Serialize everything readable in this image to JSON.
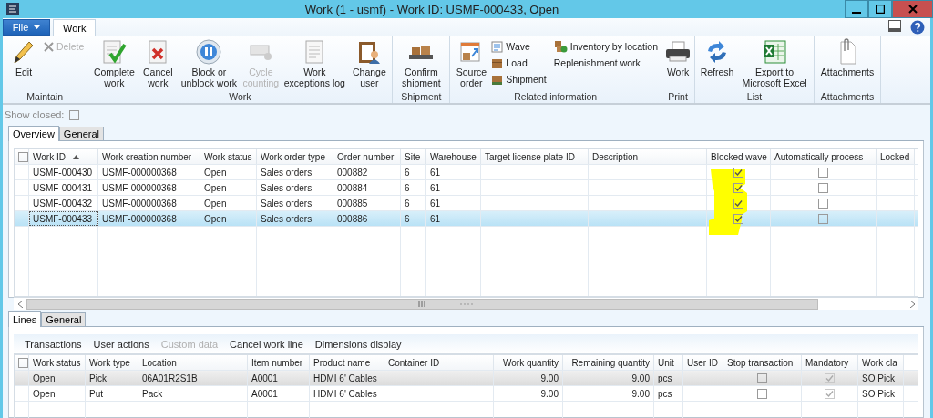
{
  "window": {
    "title": "Work (1 - usmf) - Work ID: USMF-000433, Open"
  },
  "menu": {
    "file": "File",
    "tabs": [
      {
        "label": "Work",
        "selected": true
      }
    ]
  },
  "ribbon": {
    "groups": [
      {
        "label": "Maintain",
        "buttons": [
          {
            "label": "Edit",
            "kind": "large",
            "disabled": false
          },
          {
            "label": "Delete",
            "kind": "small",
            "disabled": true
          }
        ]
      },
      {
        "label": "Work",
        "buttons": [
          {
            "label": "Complete work",
            "kind": "large",
            "disabled": false
          },
          {
            "label": "Cancel work",
            "kind": "large",
            "disabled": false
          },
          {
            "label": "Block or unblock work",
            "kind": "large",
            "disabled": false
          },
          {
            "label": "Cycle counting",
            "kind": "large",
            "disabled": true
          },
          {
            "label": "Work exceptions log",
            "kind": "large",
            "disabled": false
          },
          {
            "label": "Change user",
            "kind": "large",
            "disabled": false
          }
        ]
      },
      {
        "label": "Shipment",
        "buttons": [
          {
            "label": "Confirm shipment",
            "kind": "large",
            "disabled": false
          }
        ]
      },
      {
        "label": "Related information",
        "buttons": [
          {
            "label": "Source order",
            "kind": "large",
            "disabled": false
          },
          {
            "label": "Wave",
            "kind": "small",
            "disabled": false
          },
          {
            "label": "Load",
            "kind": "small",
            "disabled": false
          },
          {
            "label": "Shipment",
            "kind": "small",
            "disabled": false
          },
          {
            "label": "Inventory by location",
            "kind": "small",
            "disabled": false
          },
          {
            "label": "Replenishment work",
            "kind": "small",
            "disabled": false
          }
        ]
      },
      {
        "label": "Print",
        "buttons": [
          {
            "label": "Work",
            "kind": "large",
            "disabled": false
          }
        ]
      },
      {
        "label": "List",
        "buttons": [
          {
            "label": "Refresh",
            "kind": "large",
            "disabled": false
          },
          {
            "label": "Export to Microsoft Excel",
            "kind": "large",
            "disabled": false
          }
        ]
      },
      {
        "label": "Attachments",
        "buttons": [
          {
            "label": "Attachments",
            "kind": "large",
            "disabled": false
          }
        ]
      }
    ]
  },
  "show_closed": {
    "label": "Show closed:",
    "checked": false
  },
  "header_section": {
    "tabs": [
      {
        "label": "Overview",
        "selected": true
      },
      {
        "label": "General",
        "selected": false
      }
    ],
    "grid": {
      "select_all_checked": false,
      "columns": [
        {
          "label": "Work ID",
          "kind": "text",
          "sort_ascending": true
        },
        {
          "label": "Work creation number",
          "kind": "text"
        },
        {
          "label": "Work status",
          "kind": "text"
        },
        {
          "label": "Work order type",
          "kind": "text"
        },
        {
          "label": "Order number",
          "kind": "text"
        },
        {
          "label": "Site",
          "kind": "text"
        },
        {
          "label": "Warehouse",
          "kind": "text"
        },
        {
          "label": "Target license plate ID",
          "kind": "text"
        },
        {
          "label": "Description",
          "kind": "text"
        },
        {
          "label": "Blocked wave",
          "kind": "check"
        },
        {
          "label": "Automatically process",
          "kind": "check"
        },
        {
          "label": "Locked",
          "kind": "text"
        }
      ],
      "rows": [
        {
          "selected": false,
          "cells": [
            "USMF-000430",
            "USMF-000000368",
            "Open",
            "Sales orders",
            "000882",
            "6",
            "61",
            "",
            "",
            true,
            false,
            ""
          ]
        },
        {
          "selected": false,
          "cells": [
            "USMF-000431",
            "USMF-000000368",
            "Open",
            "Sales orders",
            "000884",
            "6",
            "61",
            "",
            "",
            true,
            false,
            ""
          ]
        },
        {
          "selected": false,
          "cells": [
            "USMF-000432",
            "USMF-000000368",
            "Open",
            "Sales orders",
            "000885",
            "6",
            "61",
            "",
            "",
            true,
            false,
            ""
          ]
        },
        {
          "selected": true,
          "cells": [
            "USMF-000433",
            "USMF-000000368",
            "Open",
            "Sales orders",
            "000886",
            "6",
            "61",
            "",
            "",
            true,
            false,
            ""
          ]
        }
      ]
    }
  },
  "lines_section": {
    "tabs": [
      {
        "label": "Lines",
        "selected": true
      },
      {
        "label": "General",
        "selected": false
      }
    ],
    "actions": [
      {
        "label": "Transactions",
        "disabled": false
      },
      {
        "label": "User actions",
        "disabled": false
      },
      {
        "label": "Custom data",
        "disabled": true
      },
      {
        "label": "Cancel work line",
        "disabled": false
      },
      {
        "label": "Dimensions display",
        "disabled": false
      }
    ],
    "grid": {
      "select_all_checked": false,
      "columns": [
        {
          "label": "Work status",
          "kind": "text"
        },
        {
          "label": "Work type",
          "kind": "text"
        },
        {
          "label": "Location",
          "kind": "text"
        },
        {
          "label": "Item number",
          "kind": "text"
        },
        {
          "label": "Product name",
          "kind": "text"
        },
        {
          "label": "Container ID",
          "kind": "text"
        },
        {
          "label": "Work quantity",
          "kind": "number"
        },
        {
          "label": "Remaining quantity",
          "kind": "number"
        },
        {
          "label": "Unit",
          "kind": "text"
        },
        {
          "label": "User ID",
          "kind": "text"
        },
        {
          "label": "Stop transaction",
          "kind": "check"
        },
        {
          "label": "Mandatory",
          "kind": "check",
          "disabled": true
        },
        {
          "label": "Work cla",
          "kind": "text"
        }
      ],
      "rows": [
        {
          "selected": true,
          "cells": [
            "Open",
            "Pick",
            "06A01R2S1B",
            "A0001",
            "HDMI 6' Cables",
            "",
            "9.00",
            "9.00",
            "pcs",
            "",
            false,
            true,
            "SO Pick"
          ]
        },
        {
          "selected": false,
          "cells": [
            "Open",
            "Put",
            "Pack",
            "A0001",
            "HDMI 6' Cables",
            "",
            "9.00",
            "9.00",
            "pcs",
            "",
            false,
            true,
            "SO Pick"
          ]
        }
      ]
    }
  }
}
